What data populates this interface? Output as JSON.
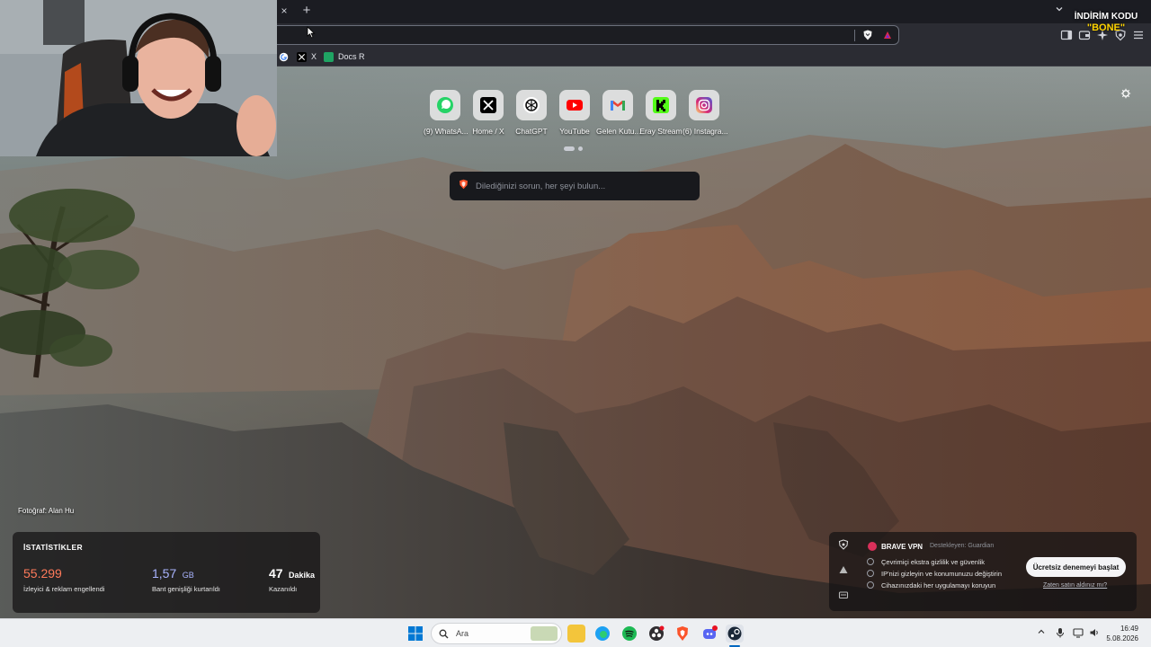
{
  "browser": {
    "tab_close_glyph": "×",
    "new_tab_glyph": "+",
    "url_value": "",
    "bookmarks": [
      {
        "label": "X",
        "icon": "x-icon"
      },
      {
        "label": "Docs R",
        "icon": "docs-icon"
      }
    ],
    "colors": {
      "accent": "#fb542b",
      "chrome": "#2b2c33"
    }
  },
  "stream_overlay": {
    "promo_line1": "İNDİRİM KODU",
    "promo_line2": "\"BONE\""
  },
  "new_tab_page": {
    "top_sites": [
      {
        "label": "(9) WhatsA...",
        "icon": "whatsapp-icon",
        "color": "#25d366"
      },
      {
        "label": "Home / X",
        "icon": "x-icon",
        "color": "#000000"
      },
      {
        "label": "ChatGPT",
        "icon": "chatgpt-icon",
        "color": "#111111"
      },
      {
        "label": "YouTube",
        "icon": "youtube-icon",
        "color": "#ff0000"
      },
      {
        "label": "Gelen Kutu...",
        "icon": "gmail-icon",
        "color": "#ea4335"
      },
      {
        "label": "Eray Stream",
        "icon": "kick-icon",
        "color": "#53fc18"
      },
      {
        "label": "(6) Instagra...",
        "icon": "instagram-icon",
        "color": "#d62976"
      }
    ],
    "search_placeholder": "Dilediğinizi sorun, her şeyi bulun...",
    "photo_credit": "Fotoğraf: Alan Hu",
    "stats": {
      "title": "İSTATİSTİKLER",
      "items": [
        {
          "value": "55.299",
          "unit": "",
          "desc": "İzleyici & reklam engellendi",
          "color": "#ff7a5a"
        },
        {
          "value": "1,57",
          "unit": "GB",
          "desc": "Bant genişliği kurtarıldı",
          "color": "#a9b4ff"
        },
        {
          "value": "47",
          "unit": "Dakika",
          "desc": "Kazanıldı",
          "color": "#ffffff"
        }
      ]
    },
    "vpn": {
      "title": "BRAVE VPN",
      "support": "Destekleyen: Guardian",
      "features": [
        "Çevrimiçi ekstra gizlilik ve güvenlik",
        "IP'nizi gizleyin ve konumunuzu değiştirin",
        "Cihazınızdaki her uygulamayı koruyun"
      ],
      "cta": "Ücretsiz denemeyi başlat",
      "link": "Zaten satın aldınız mı?"
    }
  },
  "taskbar": {
    "search_label": "Ara",
    "time": "16:49",
    "date": "5.08.2026"
  }
}
